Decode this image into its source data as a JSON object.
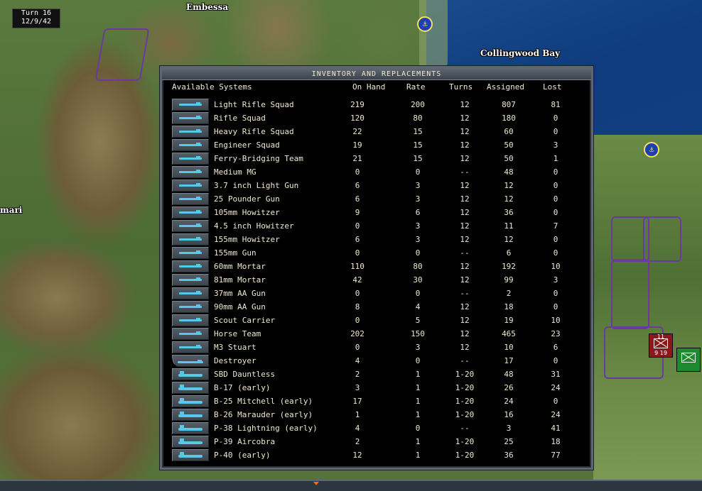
{
  "map": {
    "turn_label": "Turn 16",
    "date_label": "12/9/42",
    "places": [
      "Embessa",
      "Collingwood Bay",
      "mari"
    ],
    "units": [
      {
        "top": "11",
        "nums": "9 19",
        "color": "#8a1a1a"
      },
      {
        "top": "",
        "nums": "",
        "color": "#1e8a2e"
      }
    ]
  },
  "dialog": {
    "title": "INVENTORY AND REPLACEMENTS",
    "columns": {
      "systems": "Available Systems",
      "on_hand": "On Hand",
      "rate": "Rate",
      "turns": "Turns",
      "assigned": "Assigned",
      "lost": "Lost"
    },
    "rows": [
      {
        "name": "Light Rifle Squad",
        "on_hand": "219",
        "rate": "200",
        "turns": "12",
        "assigned": "807",
        "lost": "81",
        "icon": "rifle-icon"
      },
      {
        "name": "Rifle Squad",
        "on_hand": "120",
        "rate": "80",
        "turns": "12",
        "assigned": "180",
        "lost": "0",
        "icon": "rifle-icon"
      },
      {
        "name": "Heavy Rifle Squad",
        "on_hand": "22",
        "rate": "15",
        "turns": "12",
        "assigned": "60",
        "lost": "0",
        "icon": "rifle-icon"
      },
      {
        "name": "Engineer Squad",
        "on_hand": "19",
        "rate": "15",
        "turns": "12",
        "assigned": "50",
        "lost": "3",
        "icon": "rifle-icon"
      },
      {
        "name": "Ferry-Bridging Team",
        "on_hand": "21",
        "rate": "15",
        "turns": "12",
        "assigned": "50",
        "lost": "1",
        "icon": "rifle-icon"
      },
      {
        "name": "Medium MG",
        "on_hand": "0",
        "rate": "0",
        "turns": "--",
        "assigned": "48",
        "lost": "0",
        "icon": "machine-gun-icon"
      },
      {
        "name": "3.7 inch Light Gun",
        "on_hand": "6",
        "rate": "3",
        "turns": "12",
        "assigned": "12",
        "lost": "0",
        "icon": "gun-icon"
      },
      {
        "name": "25 Pounder Gun",
        "on_hand": "6",
        "rate": "3",
        "turns": "12",
        "assigned": "12",
        "lost": "0",
        "icon": "gun-icon"
      },
      {
        "name": "105mm Howitzer",
        "on_hand": "9",
        "rate": "6",
        "turns": "12",
        "assigned": "36",
        "lost": "0",
        "icon": "howitzer-icon"
      },
      {
        "name": "4.5 inch Howitzer",
        "on_hand": "0",
        "rate": "3",
        "turns": "12",
        "assigned": "11",
        "lost": "7",
        "icon": "howitzer-icon"
      },
      {
        "name": "155mm Howitzer",
        "on_hand": "6",
        "rate": "3",
        "turns": "12",
        "assigned": "12",
        "lost": "0",
        "icon": "howitzer-icon"
      },
      {
        "name": "155mm Gun",
        "on_hand": "0",
        "rate": "0",
        "turns": "--",
        "assigned": "6",
        "lost": "0",
        "icon": "gun-icon"
      },
      {
        "name": "60mm Mortar",
        "on_hand": "110",
        "rate": "80",
        "turns": "12",
        "assigned": "192",
        "lost": "10",
        "icon": "mortar-icon"
      },
      {
        "name": "81mm Mortar",
        "on_hand": "42",
        "rate": "30",
        "turns": "12",
        "assigned": "99",
        "lost": "3",
        "icon": "mortar-icon"
      },
      {
        "name": "37mm AA Gun",
        "on_hand": "0",
        "rate": "0",
        "turns": "--",
        "assigned": "2",
        "lost": "0",
        "icon": "aa-gun-icon"
      },
      {
        "name": "90mm AA Gun",
        "on_hand": "8",
        "rate": "4",
        "turns": "12",
        "assigned": "18",
        "lost": "0",
        "icon": "aa-gun-icon"
      },
      {
        "name": "Scout Carrier",
        "on_hand": "0",
        "rate": "5",
        "turns": "12",
        "assigned": "19",
        "lost": "10",
        "icon": "carrier-icon"
      },
      {
        "name": "Horse Team",
        "on_hand": "202",
        "rate": "150",
        "turns": "12",
        "assigned": "465",
        "lost": "23",
        "icon": "horse-icon"
      },
      {
        "name": "M3 Stuart",
        "on_hand": "0",
        "rate": "3",
        "turns": "12",
        "assigned": "10",
        "lost": "6",
        "icon": "tank-icon"
      },
      {
        "name": "Destroyer",
        "on_hand": "4",
        "rate": "0",
        "turns": "--",
        "assigned": "17",
        "lost": "0",
        "icon": "ship-icon"
      },
      {
        "name": "SBD Dauntless",
        "on_hand": "2",
        "rate": "1",
        "turns": "1-20",
        "assigned": "48",
        "lost": "31",
        "icon": "aircraft-icon"
      },
      {
        "name": "B-17 (early)",
        "on_hand": "3",
        "rate": "1",
        "turns": "1-20",
        "assigned": "26",
        "lost": "24",
        "icon": "aircraft-icon"
      },
      {
        "name": "B-25 Mitchell (early)",
        "on_hand": "17",
        "rate": "1",
        "turns": "1-20",
        "assigned": "24",
        "lost": "0",
        "icon": "aircraft-icon"
      },
      {
        "name": "B-26 Marauder (early)",
        "on_hand": "1",
        "rate": "1",
        "turns": "1-20",
        "assigned": "16",
        "lost": "24",
        "icon": "aircraft-icon"
      },
      {
        "name": "P-38 Lightning (early)",
        "on_hand": "4",
        "rate": "0",
        "turns": "--",
        "assigned": "3",
        "lost": "41",
        "icon": "aircraft-icon"
      },
      {
        "name": "P-39 Aircobra",
        "on_hand": "2",
        "rate": "1",
        "turns": "1-20",
        "assigned": "25",
        "lost": "18",
        "icon": "aircraft-icon"
      },
      {
        "name": "P-40 (early)",
        "on_hand": "12",
        "rate": "1",
        "turns": "1-20",
        "assigned": "36",
        "lost": "77",
        "icon": "aircraft-icon"
      }
    ]
  }
}
